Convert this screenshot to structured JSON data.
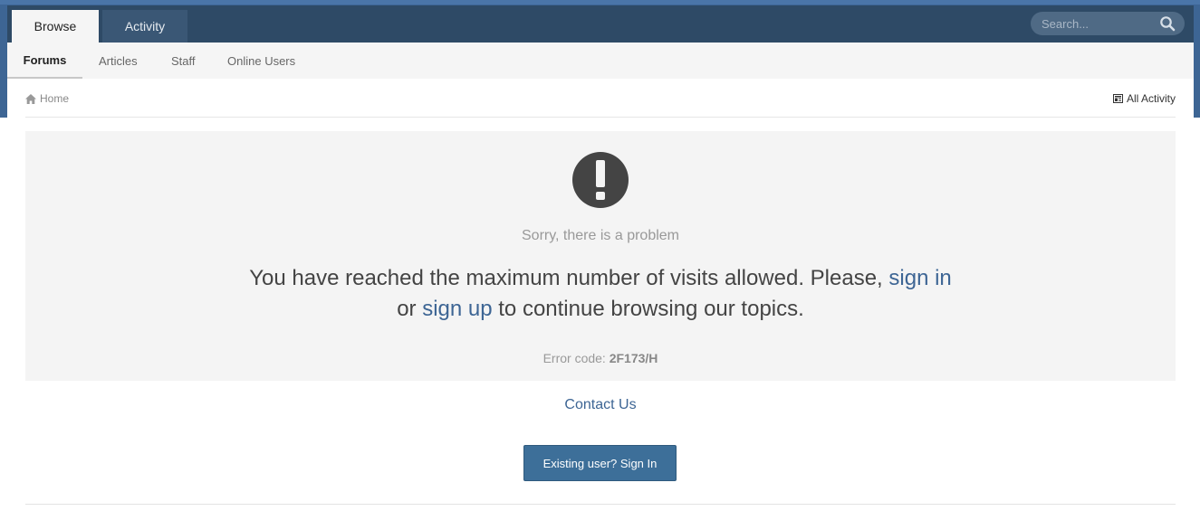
{
  "tabs": {
    "browse": "Browse",
    "activity": "Activity"
  },
  "search": {
    "placeholder": "Search..."
  },
  "subnav": {
    "forums": "Forums",
    "articles": "Articles",
    "staff": "Staff",
    "online_users": "Online Users"
  },
  "breadcrumb": {
    "home": "Home",
    "all_activity": "All Activity"
  },
  "error": {
    "title": "Sorry, there is a problem",
    "message_part1": "You have reached the maximum number of visits allowed. Please, ",
    "sign_in_link": "sign in",
    "message_part2": "or ",
    "sign_up_link": "sign up",
    "message_part3": " to continue browsing our topics.",
    "code_label": "Error code: ",
    "code_value": "2F173/H"
  },
  "footer": {
    "contact": "Contact Us",
    "sign_in_button": "Existing user? Sign In"
  },
  "colors": {
    "header_band": "#3d6594",
    "top_bar": "#2e4a66",
    "link": "#3d6594",
    "button": "#3d6f99"
  }
}
